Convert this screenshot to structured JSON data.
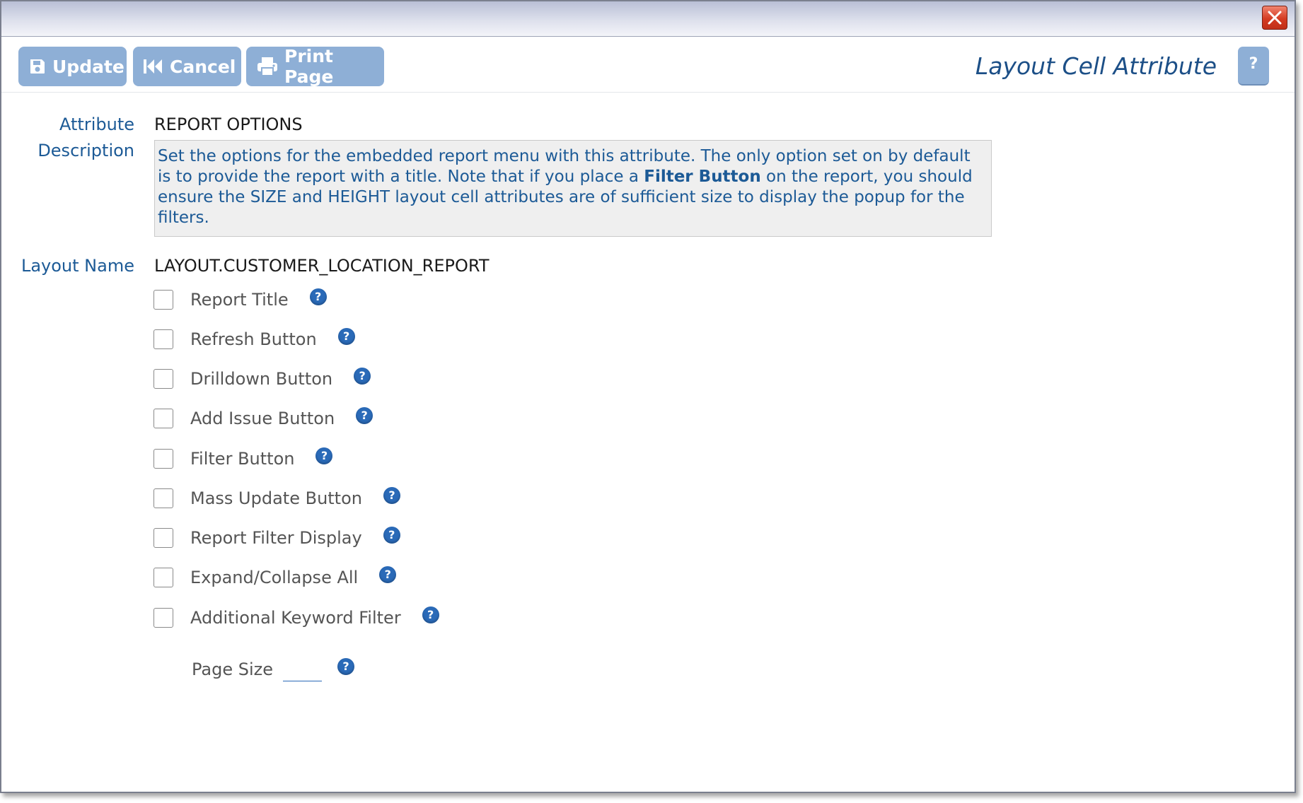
{
  "toolbar": {
    "update_label": "Update",
    "cancel_label": "Cancel",
    "print_label": "Print Page",
    "page_title": "Layout Cell Attribute",
    "help_label": "?"
  },
  "form": {
    "attribute_label": "Attribute",
    "attribute_value": "REPORT OPTIONS",
    "description_label": "Description",
    "description_part1": "Set the options for the embedded report menu with this attribute. The only option set on by default is to provide the report with a title. Note that if you place a ",
    "description_bold": "Filter Button",
    "description_part2": " on the report, you should ensure the SIZE and HEIGHT layout cell attributes are of sufficient size to display the popup for the filters.",
    "layout_name_label": "Layout Name",
    "layout_name_value": "LAYOUT.CUSTOMER_LOCATION_REPORT"
  },
  "options": [
    {
      "label": "Report Title",
      "checked": false
    },
    {
      "label": "Refresh Button",
      "checked": false
    },
    {
      "label": "Drilldown Button",
      "checked": false
    },
    {
      "label": "Add Issue Button",
      "checked": false
    },
    {
      "label": "Filter Button",
      "checked": false
    },
    {
      "label": "Mass Update Button",
      "checked": false
    },
    {
      "label": "Report Filter Display",
      "checked": false
    },
    {
      "label": "Expand/Collapse All",
      "checked": false
    },
    {
      "label": "Additional Keyword Filter",
      "checked": false
    }
  ],
  "page_size": {
    "label": "Page Size",
    "value": ""
  },
  "help_icon_glyph": "?",
  "colors": {
    "button_bg": "#8eafd6",
    "label_blue": "#1c5a96",
    "title_blue": "#1c4f87",
    "help_icon_blue": "#2a6ab8",
    "close_red": "#d43b22"
  }
}
